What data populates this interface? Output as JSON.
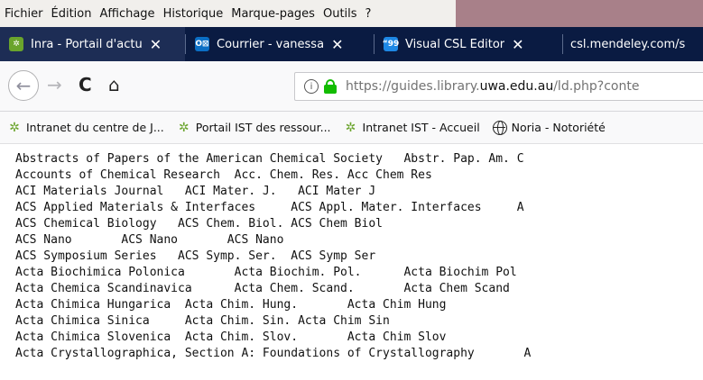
{
  "menubar": {
    "items": [
      "Fichier",
      "Édition",
      "Affichage",
      "Historique",
      "Marque-pages",
      "Outils",
      "?"
    ]
  },
  "tabs": [
    {
      "title": "Inra - Portail d'actu",
      "icon": "inra-icon",
      "active": false
    },
    {
      "title": "Courrier - vanessa",
      "icon": "outlook-icon",
      "active": true
    },
    {
      "title": "Visual CSL Editor",
      "icon": "csl-editor-icon",
      "active": false
    },
    {
      "title": "csl.mendeley.com/s",
      "icon": "",
      "active": false
    }
  ],
  "tab_icon_text": {
    "outlook": "O⊠",
    "csl": "“99"
  },
  "navbar": {
    "back_glyph": "←",
    "forward_glyph": "→",
    "reload_glyph": "C",
    "home_glyph": "⌂",
    "url_prefix": "https://guides.library.",
    "url_domain": "uwa.edu.au",
    "url_suffix": "/ld.php?conte"
  },
  "bookmarks": [
    {
      "label": "Intranet du centre de J...",
      "icon": "inra-bookmark-icon"
    },
    {
      "label": "Portail IST des ressour...",
      "icon": "inra-bookmark-icon"
    },
    {
      "label": "Intranet IST - Accueil",
      "icon": "inra-bookmark-icon"
    },
    {
      "label": "Noria - Notoriété",
      "icon": "globe-icon"
    }
  ],
  "content": {
    "lines": [
      "Abstracts of Papers of the American Chemical Society   Abstr. Pap. Am. C",
      "Accounts of Chemical Research  Acc. Chem. Res. Acc Chem Res",
      "ACI Materials Journal   ACI Mater. J.   ACI Mater J",
      "ACS Applied Materials & Interfaces     ACS Appl. Mater. Interfaces     A",
      "ACS Chemical Biology   ACS Chem. Biol. ACS Chem Biol",
      "ACS Nano       ACS Nano       ACS Nano",
      "ACS Symposium Series   ACS Symp. Ser.  ACS Symp Ser",
      "Acta Biochimica Polonica       Acta Biochim. Pol.      Acta Biochim Pol",
      "Acta Chemica Scandinavica      Acta Chem. Scand.       Acta Chem Scand",
      "Acta Chimica Hungarica  Acta Chim. Hung.       Acta Chim Hung",
      "Acta Chimica Sinica     Acta Chim. Sin. Acta Chim Sin",
      "Acta Chimica Slovenica  Acta Chim. Slov.       Acta Chim Slov",
      "Acta Crystallographica, Section A: Foundations of Crystallography       A"
    ]
  }
}
